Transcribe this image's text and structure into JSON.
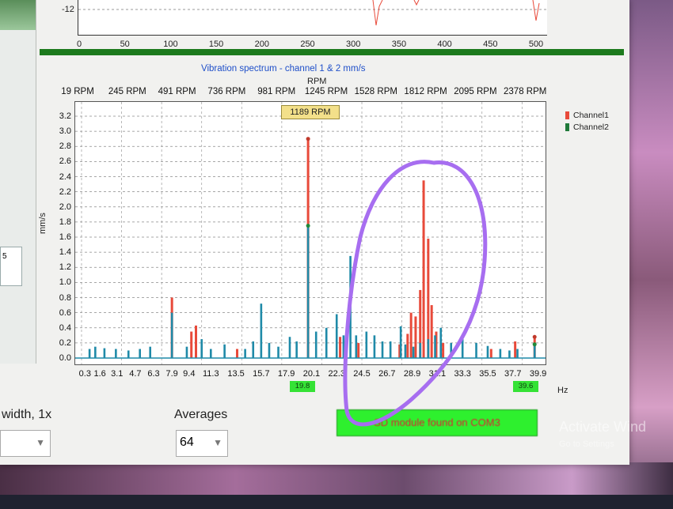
{
  "top_plot": {
    "y_tick": "-12",
    "x_ticks": [
      "0",
      "50",
      "100",
      "150",
      "200",
      "250",
      "300",
      "350",
      "400",
      "450",
      "500"
    ]
  },
  "spectrum": {
    "title": "Vibration spectrum  - channel 1 & 2 mm/s",
    "rpm_axis_label": "RPM",
    "rpm_ticks": [
      "19 RPM",
      "245 RPM",
      "491 RPM",
      "736 RPM",
      "981 RPM",
      "1245 RPM",
      "1528 RPM",
      "1812 RPM",
      "2095 RPM",
      "2378 RPM"
    ],
    "cursor_rpm": "1189 RPM",
    "y_axis_label": "mm/s",
    "x_axis_unit": "Hz",
    "cursor_hz_marker": "19.8",
    "end_hz_marker": "39.6",
    "legend": [
      {
        "name": "Channel1",
        "color": "#e84a3a"
      },
      {
        "name": "Channel2",
        "color": "#1f7a3a"
      }
    ]
  },
  "chart_data": {
    "type": "bar",
    "xlabel": "Hz",
    "ylabel": "mm/s",
    "ylim": [
      0,
      3.2
    ],
    "y_ticks": [
      "3.2",
      "3.0",
      "2.8",
      "2.6",
      "2.4",
      "2.2",
      "2.0",
      "1.8",
      "1.6",
      "1.4",
      "1.2",
      "1.0",
      "0.8",
      "0.6",
      "0.4",
      "0.2",
      "0.0"
    ],
    "x_ticks": [
      "0.3",
      "1.6",
      "3.1",
      "4.7",
      "6.3",
      "7.9",
      "9.4",
      "11.3",
      "13.5",
      "15.7",
      "17.9",
      "20.1",
      "22.3",
      "24.5",
      "26.7",
      "28.9",
      "31.1",
      "33.3",
      "35.5",
      "37.7",
      "39.9"
    ],
    "series": [
      {
        "name": "Channel1",
        "color": "#e84a3a",
        "points": [
          [
            7.9,
            0.8
          ],
          [
            9.6,
            0.35
          ],
          [
            10.0,
            0.43
          ],
          [
            13.6,
            0.12
          ],
          [
            19.8,
            2.9
          ],
          [
            22.6,
            0.28
          ],
          [
            24.2,
            0.2
          ],
          [
            27.8,
            0.18
          ],
          [
            28.5,
            0.32
          ],
          [
            28.8,
            0.6
          ],
          [
            29.2,
            0.55
          ],
          [
            29.6,
            0.9
          ],
          [
            29.9,
            2.35
          ],
          [
            30.3,
            1.58
          ],
          [
            30.6,
            0.7
          ],
          [
            31.0,
            0.35
          ],
          [
            31.6,
            0.2
          ],
          [
            35.8,
            0.12
          ],
          [
            37.9,
            0.22
          ],
          [
            39.6,
            0.28
          ]
        ]
      },
      {
        "name": "Channel2",
        "color": "#1f8aa8",
        "points": [
          [
            0.7,
            0.12
          ],
          [
            1.2,
            0.15
          ],
          [
            2.0,
            0.13
          ],
          [
            3.0,
            0.12
          ],
          [
            4.1,
            0.1
          ],
          [
            5.1,
            0.12
          ],
          [
            6.0,
            0.15
          ],
          [
            7.9,
            0.6
          ],
          [
            9.2,
            0.15
          ],
          [
            10.5,
            0.25
          ],
          [
            11.3,
            0.12
          ],
          [
            12.5,
            0.18
          ],
          [
            14.3,
            0.12
          ],
          [
            15.0,
            0.22
          ],
          [
            15.7,
            0.72
          ],
          [
            16.4,
            0.2
          ],
          [
            17.2,
            0.15
          ],
          [
            18.2,
            0.28
          ],
          [
            18.8,
            0.22
          ],
          [
            19.8,
            1.75
          ],
          [
            20.5,
            0.35
          ],
          [
            21.4,
            0.4
          ],
          [
            22.3,
            0.58
          ],
          [
            22.9,
            0.3
          ],
          [
            23.5,
            1.35
          ],
          [
            24.0,
            0.3
          ],
          [
            24.9,
            0.35
          ],
          [
            25.6,
            0.3
          ],
          [
            26.3,
            0.22
          ],
          [
            27.0,
            0.22
          ],
          [
            27.9,
            0.42
          ],
          [
            28.3,
            0.18
          ],
          [
            29.0,
            0.15
          ],
          [
            29.6,
            0.2
          ],
          [
            30.3,
            0.25
          ],
          [
            30.9,
            0.3
          ],
          [
            31.4,
            0.4
          ],
          [
            32.3,
            0.2
          ],
          [
            33.3,
            0.25
          ],
          [
            34.5,
            0.2
          ],
          [
            35.5,
            0.16
          ],
          [
            36.6,
            0.12
          ],
          [
            37.4,
            0.1
          ],
          [
            38.1,
            0.12
          ],
          [
            39.6,
            0.18
          ]
        ]
      }
    ]
  },
  "controls": {
    "bandwidth_label": "width, 1x",
    "averages_label": "Averages",
    "averages_value": "64",
    "status_text": "SD module found on COM3"
  },
  "watermark": {
    "line1": "Activate Wind",
    "line2": "Go to Settings"
  }
}
